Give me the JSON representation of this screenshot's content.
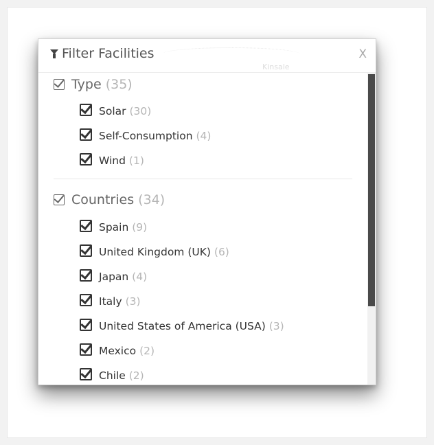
{
  "panel": {
    "title": "Filter Facilities",
    "close_label": "X",
    "map_town": "Kinsale",
    "scroll_position_fraction": 0.0
  },
  "groups": [
    {
      "label": "Type",
      "count": "(35)",
      "checked": true,
      "items": [
        {
          "label": "Solar",
          "count": "(30)",
          "checked": true
        },
        {
          "label": "Self-Consumption",
          "count": "(4)",
          "checked": true
        },
        {
          "label": "Wind",
          "count": "(1)",
          "checked": true
        }
      ]
    },
    {
      "label": "Countries",
      "count": "(34)",
      "checked": true,
      "items": [
        {
          "label": "Spain",
          "count": "(9)",
          "checked": true
        },
        {
          "label": "United Kingdom (UK)",
          "count": "(6)",
          "checked": true
        },
        {
          "label": "Japan",
          "count": "(4)",
          "checked": true
        },
        {
          "label": "Italy",
          "count": "(3)",
          "checked": true
        },
        {
          "label": "United States of America (USA)",
          "count": "(3)",
          "checked": true
        },
        {
          "label": "Mexico",
          "count": "(2)",
          "checked": true
        },
        {
          "label": "Chile",
          "count": "(2)",
          "checked": true
        }
      ]
    }
  ],
  "colors": {
    "text": "#333333",
    "muted": "#b5b5b5",
    "scroll_thumb": "#4a4a4a"
  }
}
